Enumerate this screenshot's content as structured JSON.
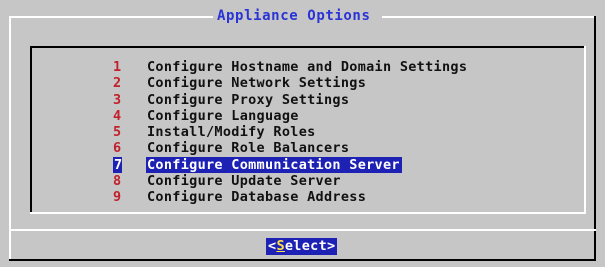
{
  "dialog": {
    "title": "Appliance Options",
    "menu": [
      {
        "number": "1",
        "label": "Configure Hostname and Domain Settings"
      },
      {
        "number": "2",
        "label": "Configure Network Settings"
      },
      {
        "number": "3",
        "label": "Configure Proxy Settings"
      },
      {
        "number": "4",
        "label": "Configure Language"
      },
      {
        "number": "5",
        "label": "Install/Modify Roles"
      },
      {
        "number": "6",
        "label": "Configure Role Balancers"
      },
      {
        "number": "7",
        "label": "Configure Communication Server",
        "selected": true
      },
      {
        "number": "8",
        "label": "Configure Update Server"
      },
      {
        "number": "9",
        "label": "Configure Database Address"
      }
    ],
    "button": {
      "open": "<",
      "hotkey": "S",
      "rest": "elect",
      "close": ">"
    }
  },
  "colors": {
    "background": "#c6c6c6",
    "title": "#2a33d6",
    "number": "#c2202c",
    "highlight": "#1e22b4",
    "hotkey": "#ffe14a"
  }
}
